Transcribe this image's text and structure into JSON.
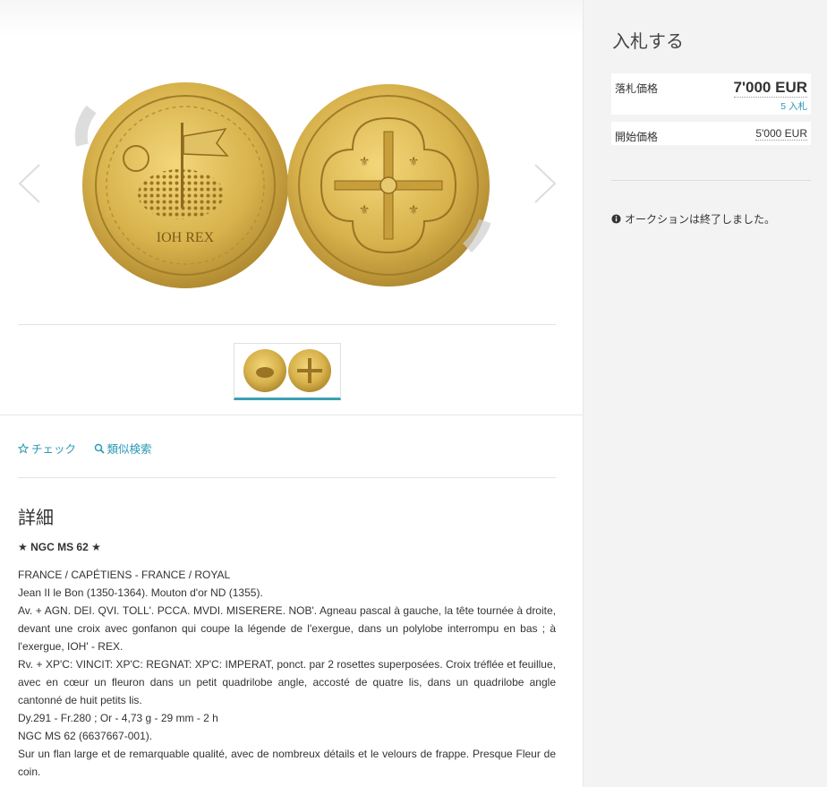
{
  "actions": {
    "check_label": "チェック",
    "similar_label": "類似検索"
  },
  "details": {
    "title": "詳細",
    "grade": "★ NGC MS 62 ★",
    "lines": [
      "FRANCE / CAPÉTIENS - FRANCE / ROYAL",
      "Jean II le Bon (1350-1364). Mouton d'or ND (1355).",
      "Av. + AGN. DEI. QVI. TOLL'. PCCA. MVDI. MISERERE. NOB'. Agneau pascal à gauche, la tête tournée à droite, devant une croix avec gonfanon qui coupe la légende de l'exergue, dans un polylobe interrompu en bas ; à l'exergue, IOH' - REX.",
      "Rv. + XP'C: VINCIT: XP'C: REGNAT: XP'C: IMPERAT, ponct. par 2 rosettes superposées. Croix tréflée et feuillue, avec en cœur un fleuron dans un petit quadrilobe angle, accosté de quatre lis, dans un quadrilobe angle cantonné de huit petits lis.",
      "Dy.291 - Fr.280 ; Or - 4,73 g - 29 mm - 2 h",
      "NGC MS 62 (6637667-001).",
      "Sur un flan large et de remarquable qualité, avec de nombreux détails et le velours de frappe. Presque Fleur de coin."
    ]
  },
  "bid": {
    "title": "入札する",
    "hammer_label": "落札価格",
    "hammer_value": "7'000 EUR",
    "bid_count": "5 入札",
    "start_label": "開始価格",
    "start_value": "5'000 EUR",
    "status": "オークションは終了しました。"
  },
  "colors": {
    "accent": "#2c9ab7",
    "gold": "#d9b44a",
    "panel": "#f3f3f3"
  },
  "icons": [
    "chevron-left-icon",
    "chevron-right-icon",
    "star-outline-icon",
    "search-icon",
    "info-icon"
  ]
}
